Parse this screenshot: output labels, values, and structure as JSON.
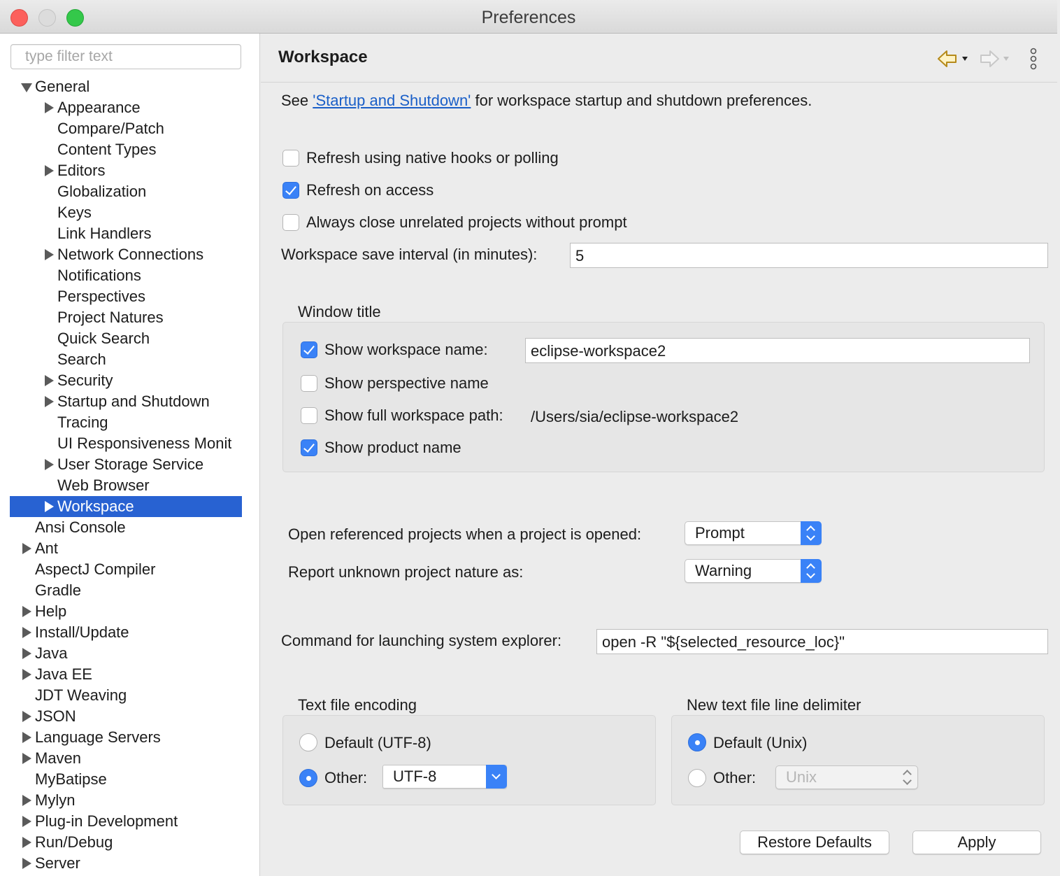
{
  "window": {
    "title": "Preferences"
  },
  "sidebar": {
    "filter_placeholder": "type filter text",
    "items": [
      {
        "label": "General",
        "expander": "expanded"
      },
      {
        "label": "Appearance",
        "expander": "collapsed"
      },
      {
        "label": "Compare/Patch",
        "expander": "none"
      },
      {
        "label": "Content Types",
        "expander": "none"
      },
      {
        "label": "Editors",
        "expander": "collapsed"
      },
      {
        "label": "Globalization",
        "expander": "none"
      },
      {
        "label": "Keys",
        "expander": "none"
      },
      {
        "label": "Link Handlers",
        "expander": "none"
      },
      {
        "label": "Network Connections",
        "expander": "collapsed"
      },
      {
        "label": "Notifications",
        "expander": "none"
      },
      {
        "label": "Perspectives",
        "expander": "none"
      },
      {
        "label": "Project Natures",
        "expander": "none"
      },
      {
        "label": "Quick Search",
        "expander": "none"
      },
      {
        "label": "Search",
        "expander": "none"
      },
      {
        "label": "Security",
        "expander": "collapsed"
      },
      {
        "label": "Startup and Shutdown",
        "expander": "collapsed"
      },
      {
        "label": "Tracing",
        "expander": "none"
      },
      {
        "label": "UI Responsiveness Monit",
        "expander": "none"
      },
      {
        "label": "User Storage Service",
        "expander": "collapsed"
      },
      {
        "label": "Web Browser",
        "expander": "none"
      },
      {
        "label": "Workspace",
        "expander": "collapsed",
        "selected": true
      },
      {
        "label": "Ansi Console",
        "expander": "none"
      },
      {
        "label": "Ant",
        "expander": "collapsed"
      },
      {
        "label": "AspectJ Compiler",
        "expander": "none"
      },
      {
        "label": "Gradle",
        "expander": "none"
      },
      {
        "label": "Help",
        "expander": "collapsed"
      },
      {
        "label": "Install/Update",
        "expander": "collapsed"
      },
      {
        "label": "Java",
        "expander": "collapsed"
      },
      {
        "label": "Java EE",
        "expander": "collapsed"
      },
      {
        "label": "JDT Weaving",
        "expander": "none"
      },
      {
        "label": "JSON",
        "expander": "collapsed"
      },
      {
        "label": "Language Servers",
        "expander": "collapsed"
      },
      {
        "label": "Maven",
        "expander": "collapsed"
      },
      {
        "label": "MyBatipse",
        "expander": "none"
      },
      {
        "label": "Mylyn",
        "expander": "collapsed"
      },
      {
        "label": "Plug-in Development",
        "expander": "collapsed"
      },
      {
        "label": "Run/Debug",
        "expander": "collapsed"
      },
      {
        "label": "Server",
        "expander": "collapsed"
      }
    ]
  },
  "main": {
    "title": "Workspace",
    "intro": {
      "prefix": "See ",
      "link": "'Startup and Shutdown'",
      "suffix": " for workspace startup and shutdown preferences."
    },
    "options": {
      "refresh_native": {
        "label": "Refresh using native hooks or polling",
        "checked": false
      },
      "refresh_access": {
        "label": "Refresh on access",
        "checked": true
      },
      "close_unrelated": {
        "label": "Always close unrelated projects without prompt",
        "checked": false
      }
    },
    "save_interval": {
      "label": "Workspace save interval (in minutes):",
      "value": "5"
    },
    "window_title": {
      "heading": "Window title",
      "show_workspace_name": {
        "label": "Show workspace name:",
        "checked": true,
        "value": "eclipse-workspace2"
      },
      "show_perspective_name": {
        "label": "Show perspective name",
        "checked": false
      },
      "show_full_path": {
        "label": "Show full workspace path:",
        "checked": false,
        "value": "/Users/sia/eclipse-workspace2"
      },
      "show_product_name": {
        "label": "Show product name",
        "checked": true
      }
    },
    "open_referenced": {
      "label": "Open referenced projects when a project is opened:",
      "value": "Prompt"
    },
    "unknown_nature": {
      "label": "Report unknown project nature as:",
      "value": "Warning"
    },
    "explorer_command": {
      "label": "Command for launching system explorer:",
      "value": "open -R \"${selected_resource_loc}\""
    },
    "encoding": {
      "heading": "Text file encoding",
      "default_label": "Default (UTF-8)",
      "other_label": "Other:",
      "other_value": "UTF-8",
      "selected": "other"
    },
    "line_delimiter": {
      "heading": "New text file line delimiter",
      "default_label": "Default (Unix)",
      "other_label": "Other:",
      "other_value": "Unix",
      "selected": "default"
    },
    "buttons": {
      "restore_defaults": "Restore Defaults",
      "apply": "Apply"
    }
  },
  "colors": {
    "accent": "#3a82f7",
    "selection": "#2862d2",
    "link": "#1a5fc8"
  }
}
